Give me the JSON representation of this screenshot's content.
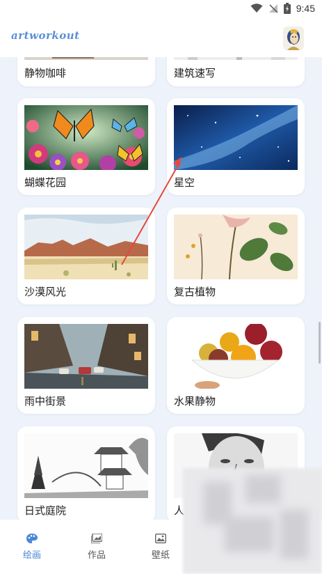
{
  "status_bar": {
    "time": "9:45"
  },
  "app": {
    "title": "artworkout"
  },
  "cards": [
    {
      "label": "静物咖啡"
    },
    {
      "label": "建筑速写"
    },
    {
      "label": "蝴蝶花园"
    },
    {
      "label": "星空"
    },
    {
      "label": "沙漠风光"
    },
    {
      "label": "复古植物"
    },
    {
      "label": "雨中街景"
    },
    {
      "label": "水果静物"
    },
    {
      "label": "日式庭院"
    },
    {
      "label": "人"
    }
  ],
  "bottom_nav": [
    {
      "label": "绘画",
      "icon": "palette-icon",
      "active": true
    },
    {
      "label": "作品",
      "icon": "gallery-icon",
      "active": false
    },
    {
      "label": "壁纸",
      "icon": "image-icon",
      "active": false
    }
  ],
  "colors": {
    "accent": "#4a86d6",
    "annotation_arrow": "#e8473c",
    "background": "#eef3fb"
  }
}
